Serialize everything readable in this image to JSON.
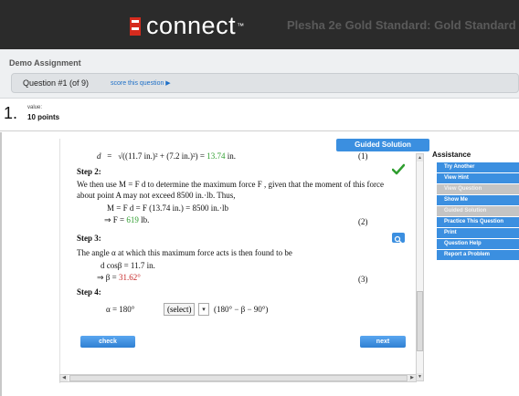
{
  "header": {
    "logo_text": "connect",
    "title": "Plesha 2e Gold Standard: Gold Standard"
  },
  "assignment": {
    "title": "Demo Assignment",
    "question_label": "Question #1 (of 9)",
    "score_link": "score this question ▶"
  },
  "question": {
    "number": "1.",
    "value_label": "value:",
    "points": "10 points"
  },
  "solution": {
    "guided_button": "Guided Solution",
    "line1": {
      "lhs": "d",
      "eq": "=",
      "expr": "√((11.7 in.)² + (7.2 in.)²) = ",
      "result": "13.74",
      "unit": " in.",
      "eqno": "(1)"
    },
    "step2_label": "Step 2:",
    "step2_text_a": "We then use M = F d to determine the maximum force F , given that the moment of this force",
    "step2_text_b": "about point A may not exceed 8500 in.·lb. Thus,",
    "line2a": "M  =  F d = F (13.74 in.) = 8500 in.·lb",
    "line2b_lhs": "⇒ F  =",
    "line2b_val": "619",
    "line2b_unit": " lb.",
    "eqno2": "(2)",
    "step3_label": "Step 3:",
    "step3_text": "The angle α at which this maximum force acts is then found to be",
    "line3a": "d cosβ  =  11.7 in.",
    "line3b_lhs": "⇒ β  =",
    "line3b_val": "31.62°",
    "eqno3": "(3)",
    "step4_label": "Step 4:",
    "line4_lhs": "α  =  180°",
    "select_value": "(select)",
    "line4_rhs": "(180° − β − 90°)",
    "check_button": "check",
    "next_button": "next"
  },
  "assistance": {
    "title": "Assistance",
    "buttons": [
      {
        "label": "Try Another",
        "enabled": true
      },
      {
        "label": "View Hint",
        "enabled": true
      },
      {
        "label": "View Question",
        "enabled": false
      },
      {
        "label": "Show Me",
        "enabled": true
      },
      {
        "label": "Guided Solution",
        "enabled": false
      },
      {
        "label": "Practice This Question",
        "enabled": true
      },
      {
        "label": "Print",
        "enabled": true
      },
      {
        "label": "Question Help",
        "enabled": true
      },
      {
        "label": "Report a Problem",
        "enabled": true
      }
    ]
  },
  "icons": {
    "check": "checkmark-icon",
    "magnify": "magnifier-icon"
  },
  "colors": {
    "header_bg": "#2b2b2b",
    "accent_blue": "#3b8fe0",
    "correct_green": "#2f9e2f",
    "incorrect_red": "#c62828",
    "brand_red": "#d52b1e"
  }
}
